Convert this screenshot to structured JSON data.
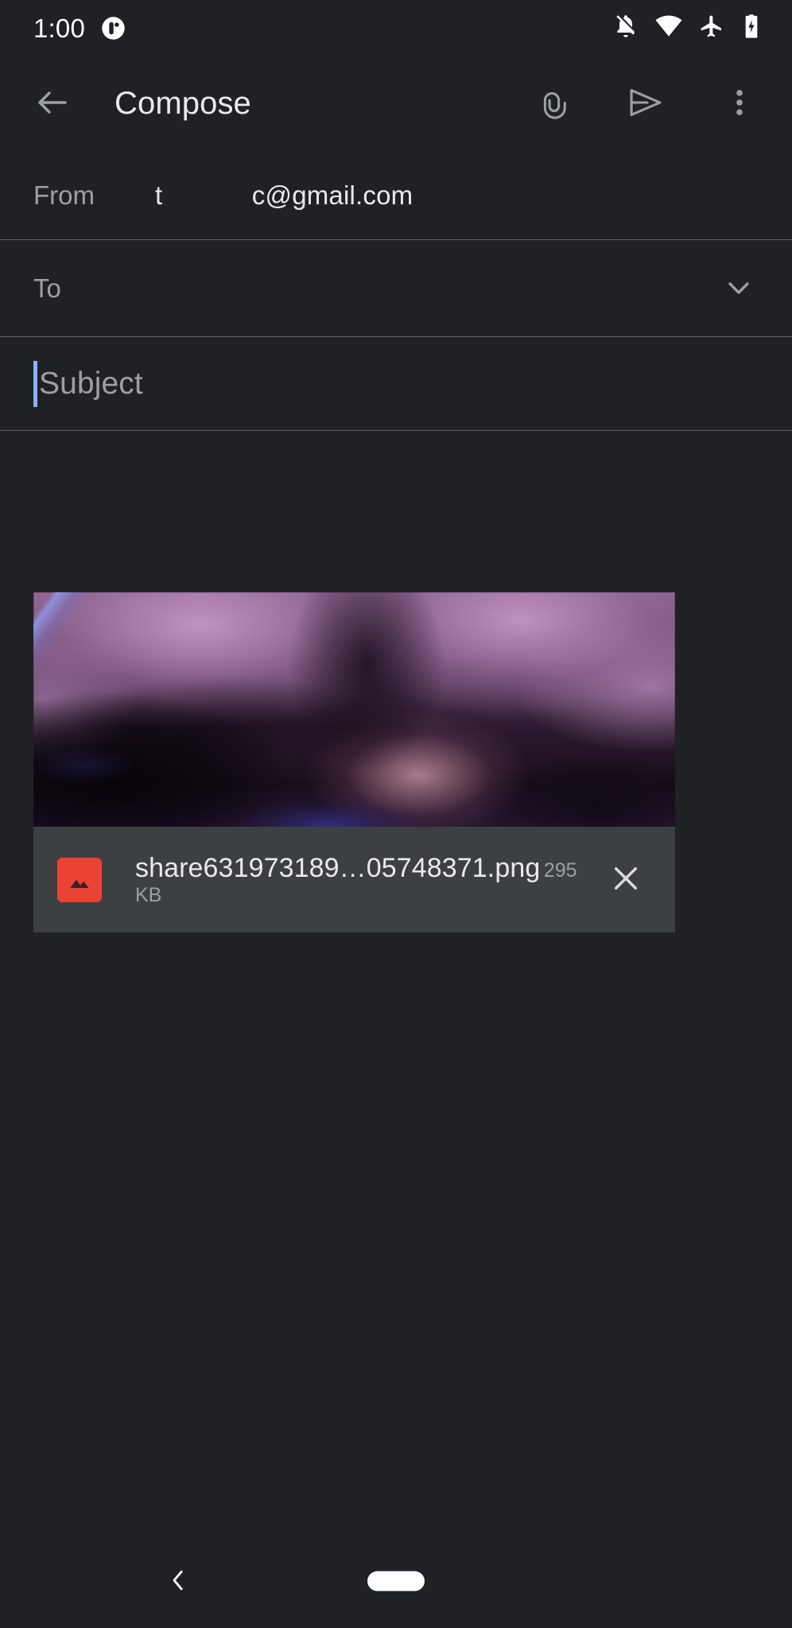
{
  "status_bar": {
    "time": "1:00",
    "app_badge_icon": "app-badge-icon",
    "icons": [
      {
        "name": "notifications-off-icon"
      },
      {
        "name": "wifi-icon"
      },
      {
        "name": "airplane-mode-icon"
      },
      {
        "name": "battery-charging-icon"
      }
    ]
  },
  "toolbar": {
    "back_label": "back-icon",
    "title": "Compose",
    "attach_label": "attach-file-icon",
    "send_label": "send-icon",
    "more_label": "more-options-icon"
  },
  "compose": {
    "from": {
      "label": "From",
      "value": "t            c@gmail.com"
    },
    "to": {
      "placeholder": "To",
      "value": "",
      "expand_icon": "chevron-down-icon"
    },
    "subject": {
      "placeholder": "Subject",
      "value": "",
      "caret_color": "#8ab4f8",
      "focused": true
    },
    "body": {
      "placeholder": "",
      "value": ""
    }
  },
  "attachment": {
    "file_name": "share631973189…05748371.png",
    "file_size": "295 KB",
    "file_type_icon": "image-file-icon",
    "remove_icon": "close-icon",
    "thumbnail_alt": "blurred purple photo thumbnail"
  },
  "nav_bar": {
    "back_icon": "nav-back-icon",
    "home_icon": "nav-home-pill"
  },
  "colors": {
    "background": "#202124",
    "divider": "#5f6368",
    "text_primary": "#e8eaed",
    "text_secondary": "#9aa0a6",
    "accent": "#8ab4f8",
    "attachment_card": "#3c4043",
    "file_icon": "#ea4335"
  }
}
